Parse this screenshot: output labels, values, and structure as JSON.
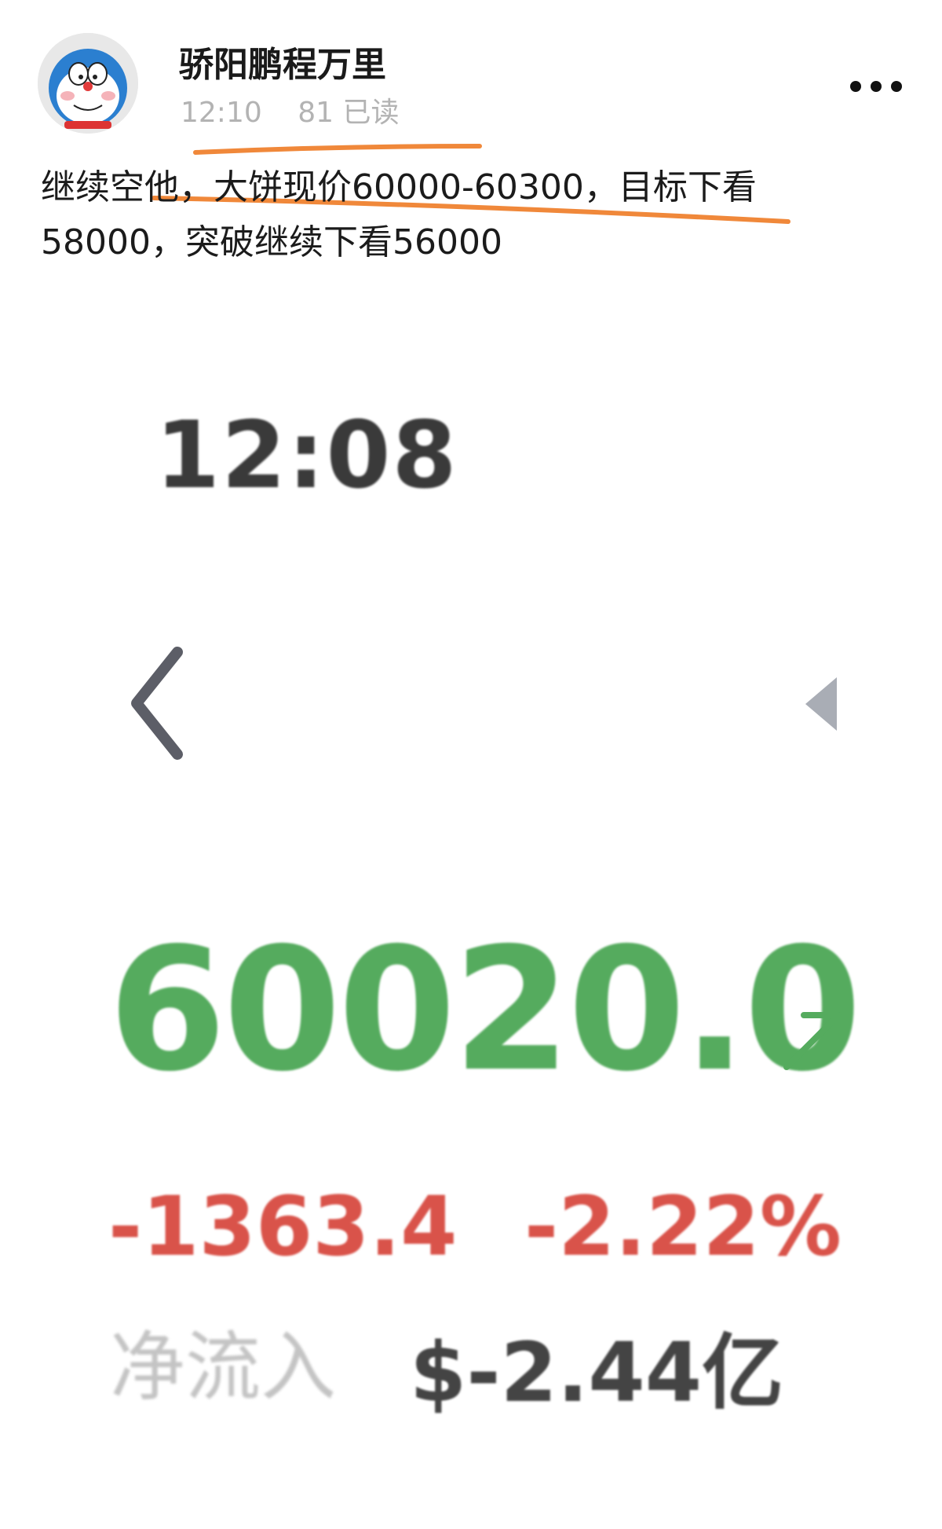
{
  "post": {
    "author": "骄阳鹏程万里",
    "time": "12:10",
    "reads": "81 已读",
    "text_line1": "继续空他，大饼现价60000-60300，目标下看",
    "text_line2": "58000，突破继续下看56000",
    "highlight_color": "#f0883a"
  },
  "screenshot": {
    "time": "12:08",
    "price": "60020.0",
    "price_color": "#55ab5e",
    "change_abs": "-1363.4",
    "change_pct": "-2.22%",
    "change_color": "#d9534a",
    "net_flow_label": "净流入",
    "net_flow_value": "$-2.44亿"
  },
  "icons": {
    "more": "more-dots-icon",
    "back": "chevron-left-icon",
    "side": "triangle-left-icon",
    "trend": "arrow-up-right-icon",
    "avatar": "doraemon-avatar"
  }
}
